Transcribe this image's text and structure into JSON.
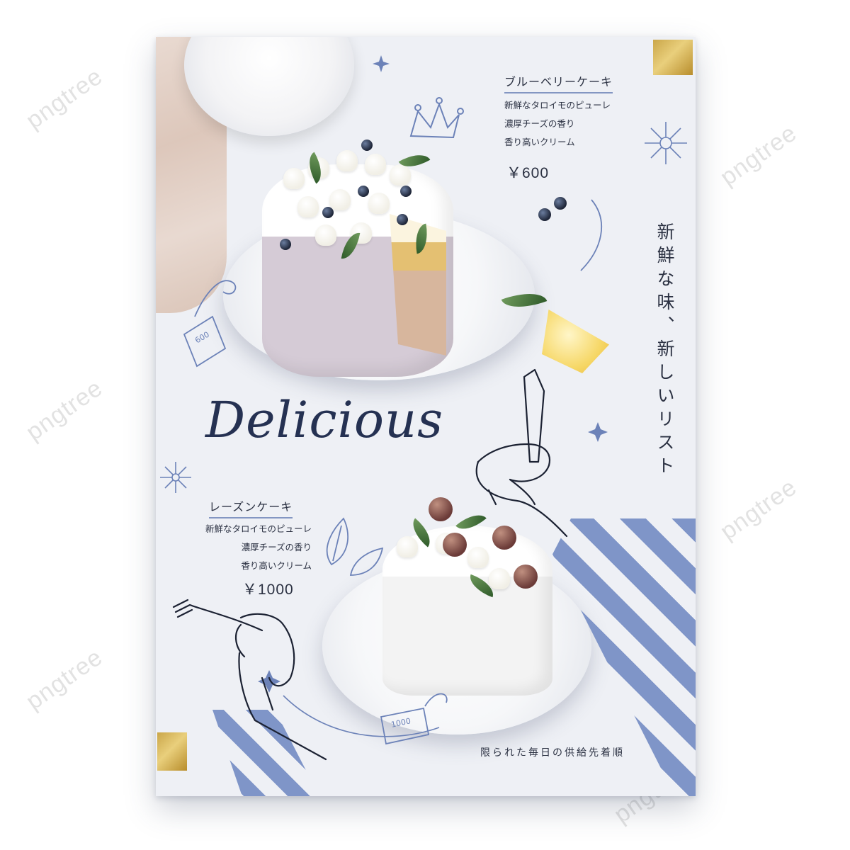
{
  "watermark": {
    "text": "pngtree"
  },
  "poster": {
    "headline": "Delicious",
    "vertical_text": "新鮮な味、新しいリスト",
    "footer_text": "限られた毎日の供給先着順",
    "accent_color": "#7f95c8",
    "gold_color": "#d4b35a"
  },
  "cake1": {
    "name": "ブルーベリーケーキ",
    "features": [
      "新鮮なタロイモのピューレ",
      "濃厚チーズの香り",
      "香り高いクリーム"
    ],
    "price": "￥600",
    "tag": "600"
  },
  "cake2": {
    "name": "レーズンケーキ",
    "features": [
      "新鮮なタロイモのピューレ",
      "濃厚チーズの香り",
      "香り高いクリーム"
    ],
    "price": "￥1000",
    "tag": "1000"
  }
}
